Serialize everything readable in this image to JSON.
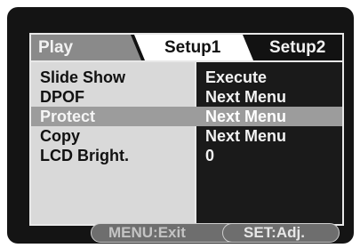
{
  "tabs": [
    {
      "label": "Play"
    },
    {
      "label": "Setup1"
    },
    {
      "label": "Setup2"
    }
  ],
  "menu_items": [
    {
      "label": "Slide Show",
      "value": "Execute"
    },
    {
      "label": "DPOF",
      "value": "Next Menu"
    },
    {
      "label": "Protect",
      "value": "Next Menu",
      "selected": true
    },
    {
      "label": "Copy",
      "value": "Next Menu"
    },
    {
      "label": "LCD Bright.",
      "value": "0"
    }
  ],
  "footer": {
    "exit_label": "MENU:Exit",
    "adjust_label": "SET:Adj."
  },
  "colors": {
    "screen_background": "#141414",
    "left_panel": "#d9d9d9",
    "selected_row": "#9c9c9c",
    "active_tab": "#8a8a8a",
    "setup1_tab": "#ffffff"
  }
}
